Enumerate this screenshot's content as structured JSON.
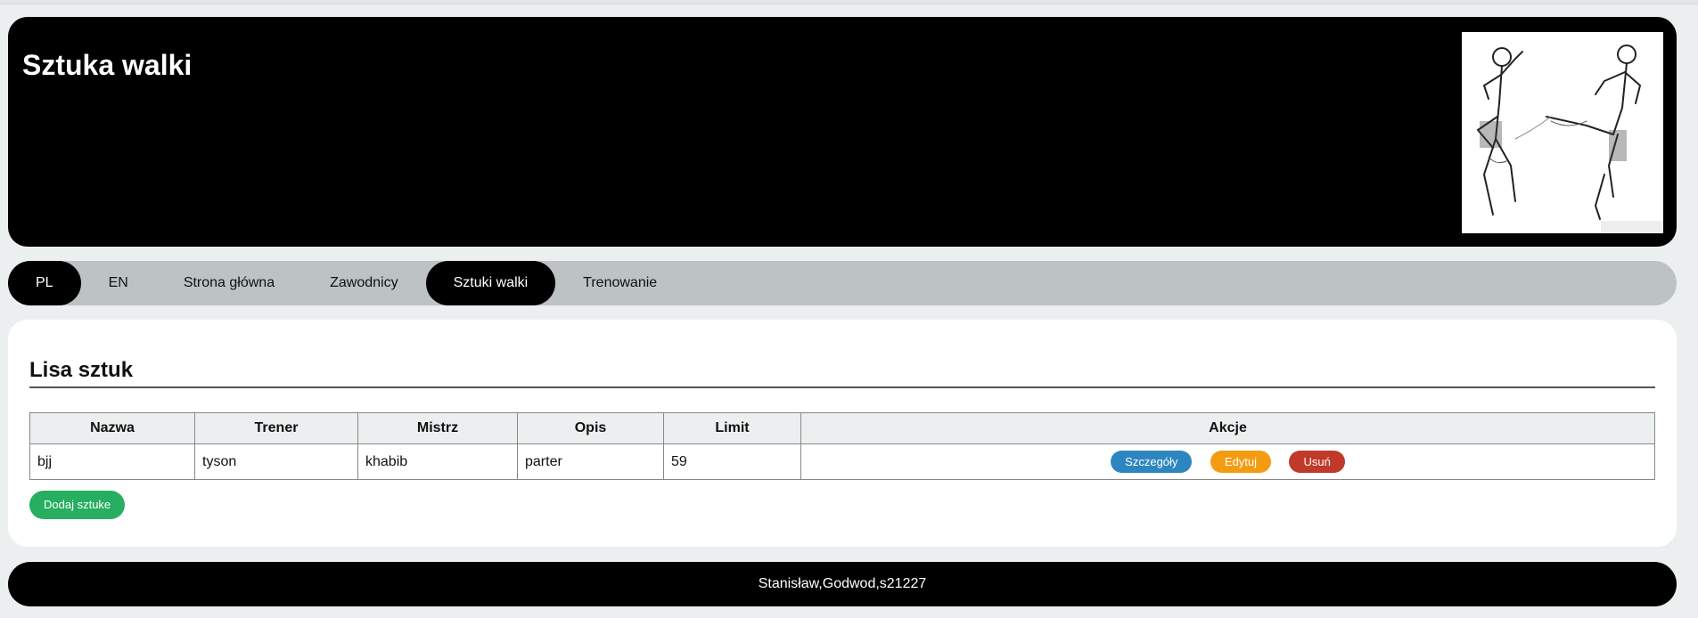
{
  "header": {
    "title": "Sztuka walki",
    "image_label": "kickboxing-sketch"
  },
  "nav": {
    "items": [
      {
        "label": "PL",
        "active": true
      },
      {
        "label": "EN",
        "active": false
      },
      {
        "label": "Strona główna",
        "active": false
      },
      {
        "label": "Zawodnicy",
        "active": false
      },
      {
        "label": "Sztuki walki",
        "active": true
      },
      {
        "label": "Trenowanie",
        "active": false
      }
    ]
  },
  "main": {
    "title": "Lisa sztuk",
    "table": {
      "headers": [
        "Nazwa",
        "Trener",
        "Mistrz",
        "Opis",
        "Limit",
        "Akcje"
      ],
      "rows": [
        {
          "nazwa": "bjj",
          "trener": "tyson",
          "mistrz": "khabib",
          "opis": "parter",
          "limit": "59"
        }
      ]
    },
    "actions": {
      "details_label": "Szczegóły",
      "edit_label": "Edytuj",
      "delete_label": "Usuń"
    },
    "add_label": "Dodaj sztuke"
  },
  "footer": {
    "text": "Stanisław,Godwod,s21227"
  },
  "colors": {
    "header_bg": "#000000",
    "nav_bg": "#bdc2c5",
    "details": "#2e86c1",
    "edit": "#f39c12",
    "delete": "#c0392b",
    "add": "#27ae60"
  }
}
